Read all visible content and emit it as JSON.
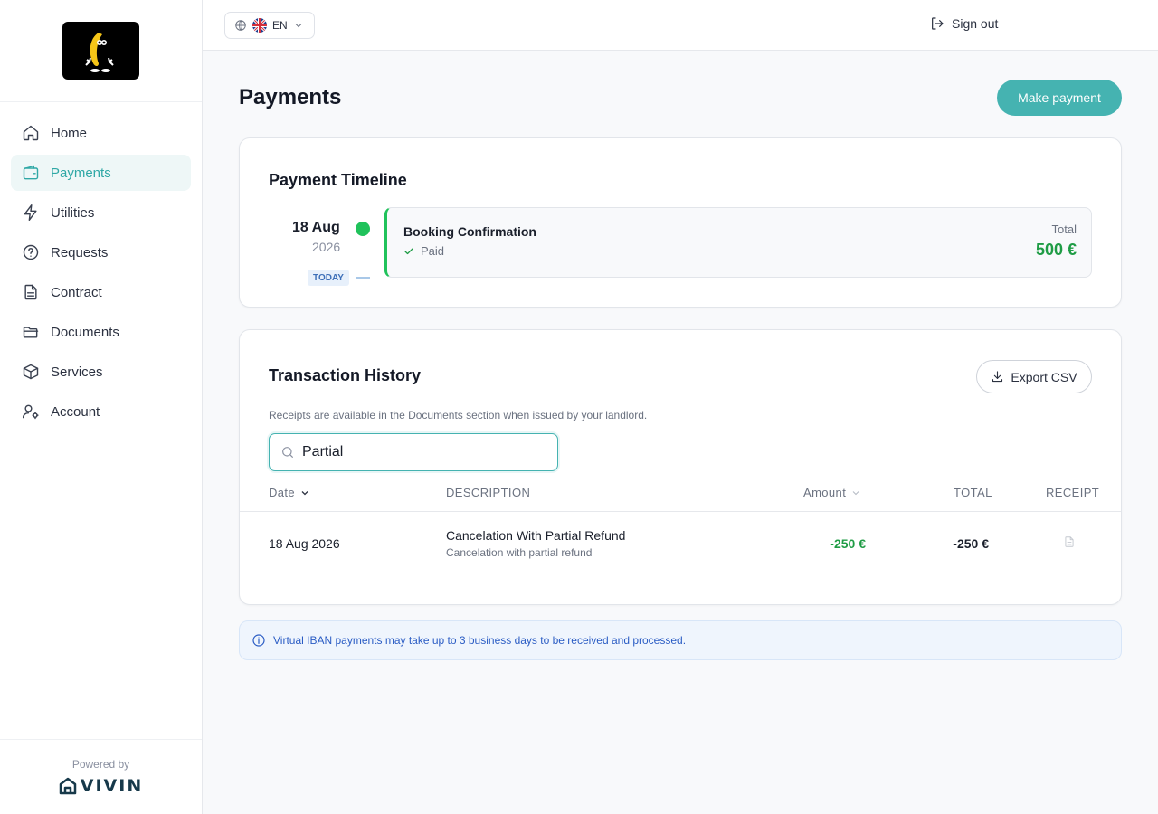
{
  "sidebar": {
    "items": [
      {
        "label": "Home"
      },
      {
        "label": "Payments"
      },
      {
        "label": "Utilities"
      },
      {
        "label": "Requests"
      },
      {
        "label": "Contract"
      },
      {
        "label": "Documents"
      },
      {
        "label": "Services"
      },
      {
        "label": "Account"
      }
    ],
    "active": "Payments",
    "footer": {
      "powered_by": "Powered by",
      "brand": "VIVIN"
    }
  },
  "topbar": {
    "language": "EN",
    "sign_out": "Sign out"
  },
  "page": {
    "title": "Payments",
    "make_payment": "Make payment"
  },
  "timeline": {
    "title": "Payment Timeline",
    "date": "18 Aug",
    "year": "2026",
    "today_badge": "TODAY",
    "entry": {
      "title": "Booking Confirmation",
      "status": "Paid",
      "total_label": "Total",
      "total": "500 €"
    }
  },
  "history": {
    "title": "Transaction History",
    "export": "Export CSV",
    "note": "Receipts are available in the Documents section when issued by your landlord.",
    "search_value": "Partial",
    "columns": {
      "date": "Date",
      "description": "DESCRIPTION",
      "amount": "Amount",
      "total": "TOTAL",
      "receipt": "RECEIPT"
    },
    "rows": [
      {
        "date": "18 Aug 2026",
        "title": "Cancelation With Partial Refund",
        "subtitle": "Cancelation with partial refund",
        "amount": "-250 €",
        "total": "-250 €"
      }
    ]
  },
  "info": {
    "text": "Virtual IBAN payments may take up to 3 business days to be received and processed."
  },
  "colors": {
    "accent": "#45b3b1",
    "success": "#20c25b",
    "info": "#2a5cc4"
  }
}
